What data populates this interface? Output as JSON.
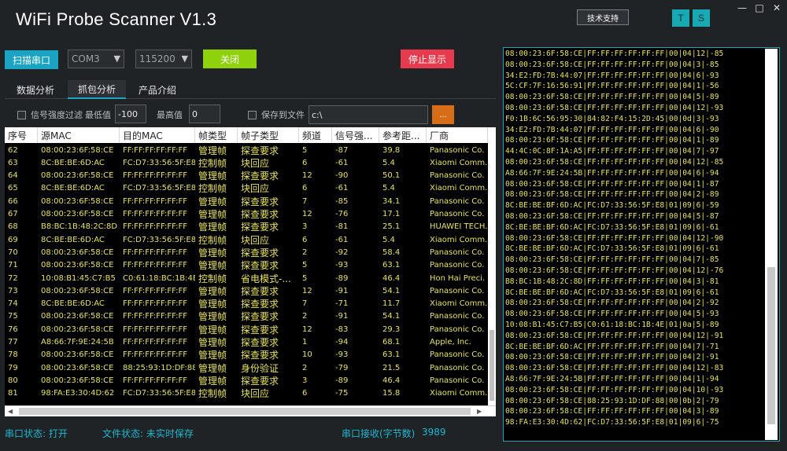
{
  "app": {
    "title": "WiFi Probe Scanner V1.3",
    "support_button": "技术支持",
    "t_button": "T",
    "s_button": "S",
    "minimize": "—",
    "maximize": "□",
    "close": "✕"
  },
  "toolbar": {
    "scan_button": "扫描串口",
    "port_select": "COM3",
    "baud_select": "115200",
    "close_button": "关闭",
    "stop_button": "停止显示"
  },
  "tabs": [
    "数据分析",
    "抓包分析",
    "产品介绍"
  ],
  "active_tab": "抓包分析",
  "filters": {
    "signal_filter_label": "信号强度过滤",
    "min_label": "最低值",
    "min_value": "-100",
    "max_label": "最高值",
    "max_value": "0",
    "save_label": "保存到文件",
    "path_value": "c:\\",
    "browse_button": "..."
  },
  "table": {
    "columns": [
      "序号",
      "源MAC",
      "目的MAC",
      "帧类型",
      "帧子类型",
      "频道",
      "信号强...",
      "参考距...",
      "厂商"
    ],
    "rows": [
      [
        "62",
        "08:00:23:6F:58:CE",
        "FF:FF:FF:FF:FF:FF",
        "管理帧",
        "探查要求",
        "5",
        "-87",
        "39.8",
        "Panasonic Co."
      ],
      [
        "63",
        "8C:BE:BE:6D:AC",
        "FC:D7:33:56:5F:E8",
        "控制帧",
        "块回应",
        "6",
        "-61",
        "5.4",
        "Xiaomi Comm."
      ],
      [
        "64",
        "08:00:23:6F:58:CE",
        "FF:FF:FF:FF:FF:FF",
        "管理帧",
        "探查要求",
        "12",
        "-90",
        "50.1",
        "Panasonic Co."
      ],
      [
        "65",
        "8C:BE:BE:6D:AC",
        "FC:D7:33:56:5F:E8",
        "控制帧",
        "块回应",
        "6",
        "-61",
        "5.4",
        "Xiaomi Comm."
      ],
      [
        "66",
        "08:00:23:6F:58:CE",
        "FF:FF:FF:FF:FF:FF",
        "管理帧",
        "探查要求",
        "7",
        "-85",
        "34.1",
        "Panasonic Co."
      ],
      [
        "67",
        "08:00:23:6F:58:CE",
        "FF:FF:FF:FF:FF:FF",
        "管理帧",
        "探查要求",
        "12",
        "-76",
        "17.1",
        "Panasonic Co."
      ],
      [
        "68",
        "B8:BC:1B:48:2C:8D",
        "FF:FF:FF:FF:FF:FF",
        "管理帧",
        "探查要求",
        "3",
        "-81",
        "25.1",
        "HUAWEI TECH."
      ],
      [
        "69",
        "8C:BE:BE:6D:AC",
        "FC:D7:33:56:5F:E8",
        "控制帧",
        "块回应",
        "6",
        "-61",
        "5.4",
        "Xiaomi Comm."
      ],
      [
        "70",
        "08:00:23:6F:58:CE",
        "FF:FF:FF:FF:FF:FF",
        "管理帧",
        "探查要求",
        "2",
        "-92",
        "58.4",
        "Panasonic Co."
      ],
      [
        "71",
        "08:00:23:6F:58:CE",
        "FF:FF:FF:FF:FF:FF",
        "管理帧",
        "探查要求",
        "5",
        "-93",
        "63.1",
        "Panasonic Co."
      ],
      [
        "72",
        "10:08:B1:45:C7:B5",
        "C0:61:18:BC:1B:4E",
        "控制帧",
        "省电模式-...",
        "5",
        "-89",
        "46.4",
        "Hon Hai Preci."
      ],
      [
        "73",
        "08:00:23:6F:58:CE",
        "FF:FF:FF:FF:FF:FF",
        "管理帧",
        "探查要求",
        "12",
        "-91",
        "54.1",
        "Panasonic Co."
      ],
      [
        "74",
        "8C:BE:BE:6D:AC",
        "FF:FF:FF:FF:FF:FF",
        "管理帧",
        "探查要求",
        "7",
        "-71",
        "11.7",
        "Xiaomi Comm."
      ],
      [
        "75",
        "08:00:23:6F:58:CE",
        "FF:FF:FF:FF:FF:FF",
        "管理帧",
        "探查要求",
        "2",
        "-91",
        "54.1",
        "Panasonic Co."
      ],
      [
        "76",
        "08:00:23:6F:58:CE",
        "FF:FF:FF:FF:FF:FF",
        "管理帧",
        "探查要求",
        "12",
        "-83",
        "29.3",
        "Panasonic Co."
      ],
      [
        "77",
        "A8:66:7F:9E:24:5B",
        "FF:FF:FF:FF:FF:FF",
        "管理帧",
        "探查要求",
        "1",
        "-94",
        "68.1",
        "Apple, Inc."
      ],
      [
        "78",
        "08:00:23:6F:58:CE",
        "FF:FF:FF:FF:FF:FF",
        "管理帧",
        "探查要求",
        "10",
        "-93",
        "63.1",
        "Panasonic Co."
      ],
      [
        "79",
        "08:00:23:6F:58:CE",
        "88:25:93:1D:DF:88",
        "管理帧",
        "身份验证",
        "2",
        "-79",
        "21.5",
        "Panasonic Co."
      ],
      [
        "80",
        "08:00:23:6F:58:CE",
        "FF:FF:FF:FF:FF:FF",
        "管理帧",
        "探查要求",
        "3",
        "-89",
        "46.4",
        "Panasonic Co."
      ],
      [
        "81",
        "98:FA:E3:30:4D:62",
        "FC:D7:33:56:5F:E8",
        "控制帧",
        "块回应",
        "6",
        "-75",
        "15.8",
        "Xiaomi Comm."
      ]
    ]
  },
  "status": {
    "port_status": "串口状态: 打开",
    "file_status": "文件状态: 未实时保存",
    "rx_label": "串口接收(字节数)",
    "rx_count": "3989"
  },
  "serial_lines": [
    "08:00:23:6F:58:CE|FF:FF:FF:FF:FF:FF|00|04|12|-85",
    "08:00:23:6F:58:CE|FF:FF:FF:FF:FF:FF|00|04|3|-85",
    "34:E2:FD:7B:44:07|FF:FF:FF:FF:FF:FF|00|04|6|-93",
    "5C:CF:7F:16:56:91|FF:FF:FF:FF:FF:FF|00|04|1|-56",
    "08:00:23:6F:58:CE|FF:FF:FF:FF:FF:FF|00|04|5|-89",
    "08:00:23:6F:58:CE|FF:FF:FF:FF:FF:FF|00|04|12|-93",
    "F0:1B:6C:56:95:30|84:82:F4:15:2D:45|00|0d|3|-93",
    "34:E2:FD:7B:44:07|FF:FF:FF:FF:FF:FF|00|04|6|-90",
    "08:00:23:6F:58:CE|FF:FF:FF:FF:FF:FF|00|04|1|-89",
    "44:4C:0C:8F:1A:A5|FF:FF:FF:FF:FF:FF|00|04|7|-97",
    "08:00:23:6F:58:CE|FF:FF:FF:FF:FF:FF|00|04|12|-85",
    "A8:66:7F:9E:24:5B|FF:FF:FF:FF:FF:FF|00|04|6|-94",
    "08:00:23:6F:58:CE|FF:FF:FF:FF:FF:FF|00|04|1|-87",
    "08:00:23:6F:58:CE|FF:FF:FF:FF:FF:FF|00|04|2|-89",
    "8C:BE:BE:BF:6D:AC|FC:D7:33:56:5F:E8|01|09|6|-59",
    "08:00:23:6F:58:CE|FF:FF:FF:FF:FF:FF|00|04|5|-87",
    "8C:BE:BE:BF:6D:AC|FC:D7:33:56:5F:E8|01|09|6|-61",
    "08:00:23:6F:58:CE|FF:FF:FF:FF:FF:FF|00|04|12|-90",
    "8C:BE:BE:BF:6D:AC|FC:D7:33:56:5F:E8|01|09|6|-61",
    "08:00:23:6F:58:CE|FF:FF:FF:FF:FF:FF|00|04|7|-85",
    "08:00:23:6F:58:CE|FF:FF:FF:FF:FF:FF|00|04|12|-76",
    "B8:BC:1B:48:2C:8D|FF:FF:FF:FF:FF:FF|00|04|3|-81",
    "8C:BE:BE:BF:6D:AC|FC:D7:33:56:5F:E8|01|09|6|-61",
    "08:00:23:6F:58:CE|FF:FF:FF:FF:FF:FF|00|04|2|-92",
    "08:00:23:6F:58:CE|FF:FF:FF:FF:FF:FF|00|04|5|-93",
    "10:08:B1:45:C7:B5|C0:61:18:BC:1B:4E|01|0a|5|-89",
    "08:00:23:6F:58:CE|FF:FF:FF:FF:FF:FF|00|04|12|-91",
    "8C:BE:BE:BF:6D:AC|FF:FF:FF:FF:FF:FF|00|04|7|-71",
    "08:00:23:6F:58:CE|FF:FF:FF:FF:FF:FF|00|04|2|-91",
    "08:00:23:6F:58:CE|FF:FF:FF:FF:FF:FF|00|04|12|-83",
    "A8:66:7F:9E:24:5B|FF:FF:FF:FF:FF:FF|00|04|1|-94",
    "08:00:23:6F:58:CE|FF:FF:FF:FF:FF:FF|00|04|10|-93",
    "08:00:23:6F:58:CE|88:25:93:1D:DF:88|00|0b|2|-79",
    "08:00:23:6F:58:CE|FF:FF:FF:FF:FF:FF|00|04|3|-89",
    "98:FA:E3:30:4D:62|FC:D7:33:56:5F:E8|01|09|6|-75"
  ],
  "colors": {
    "accent": "#19a4c0",
    "close_button": "#8fd10a",
    "stop_button": "#e83a4e",
    "browse_button": "#d86d17",
    "row_text": "#e8e25a"
  }
}
